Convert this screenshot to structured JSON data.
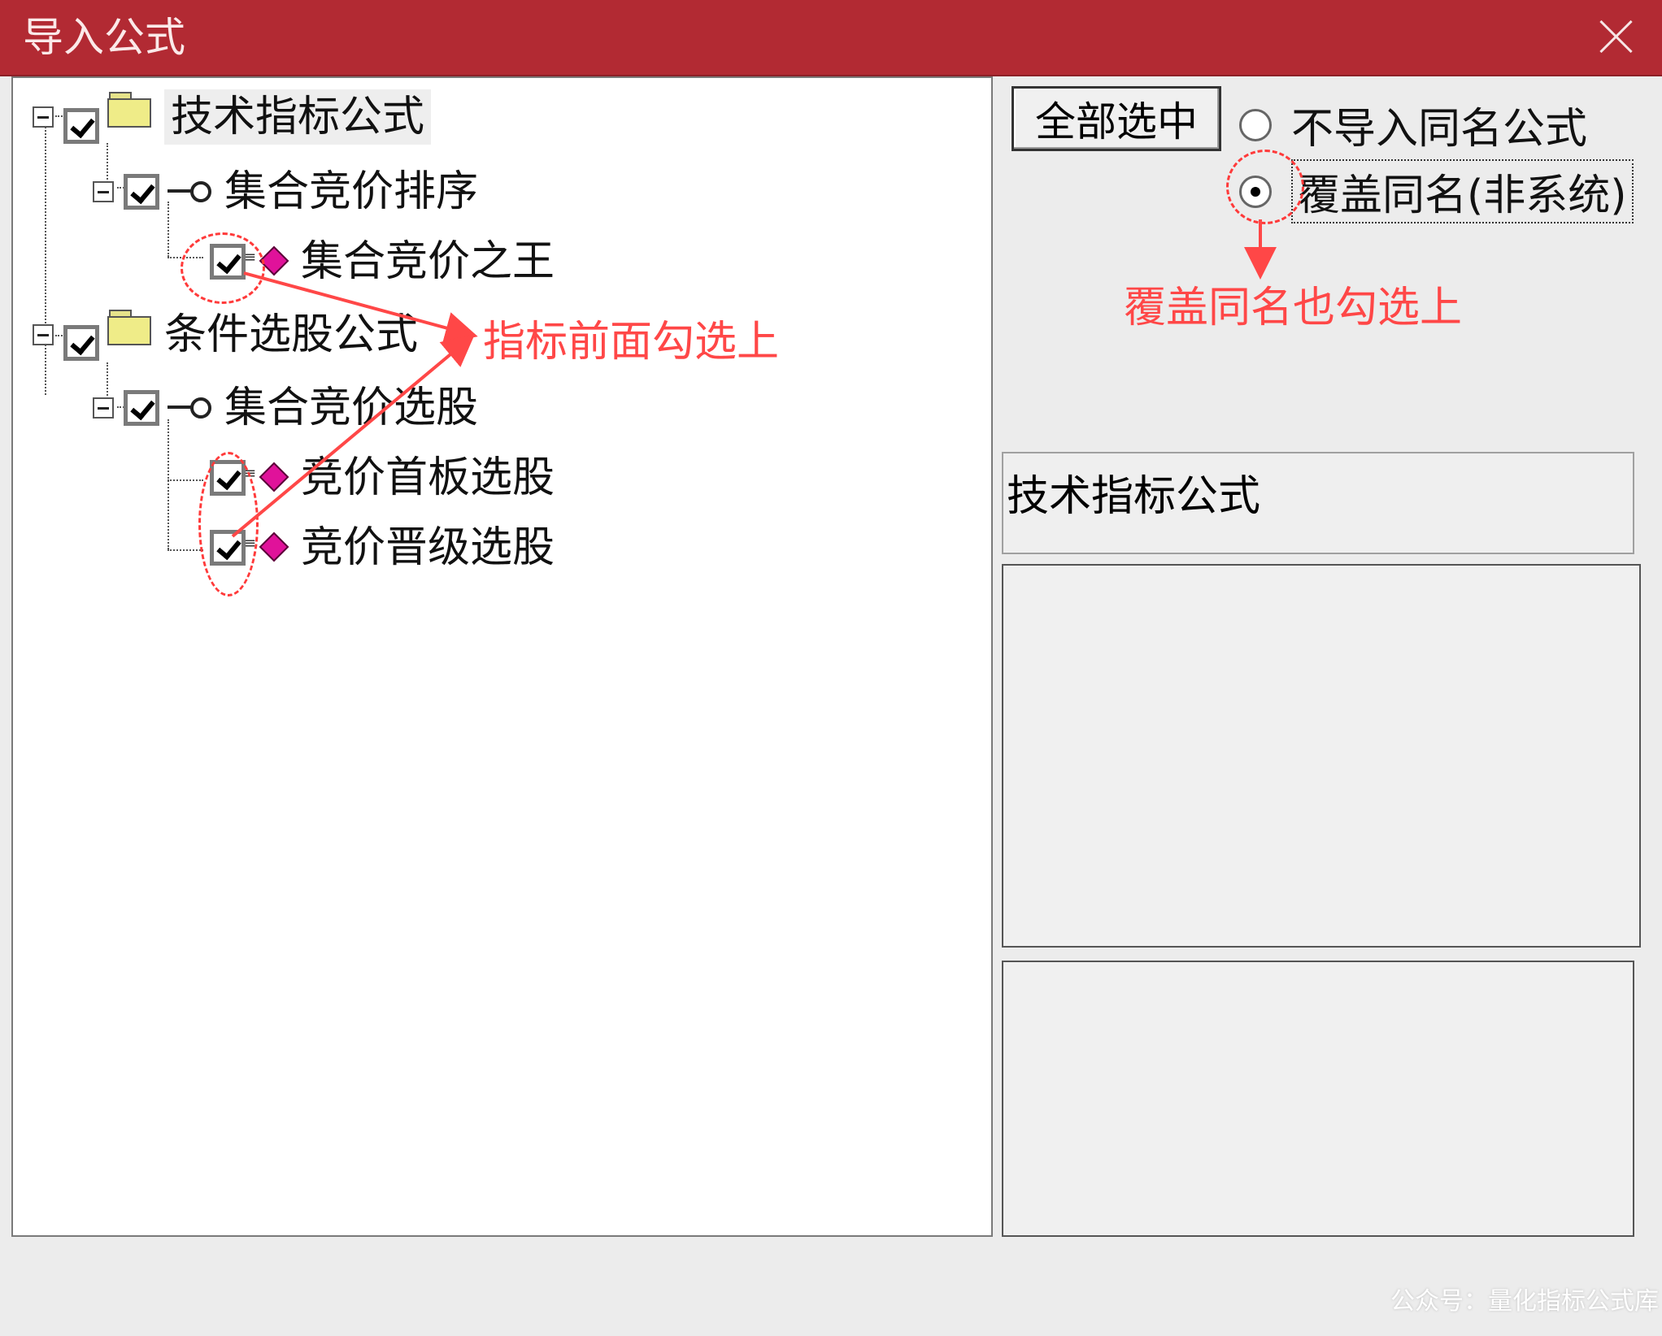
{
  "window": {
    "title": "导入公式"
  },
  "tree": {
    "items": [
      {
        "label": "技术指标公式"
      },
      {
        "label": "集合竞价排序"
      },
      {
        "label": "集合竞价之王"
      },
      {
        "label": "条件选股公式"
      },
      {
        "label": "集合竞价选股"
      },
      {
        "label": "竞价首板选股"
      },
      {
        "label": "竞价晋级选股"
      }
    ]
  },
  "options": {
    "select_all_label": "全部选中",
    "radio_no_import": "不导入同名公式",
    "radio_overwrite": "覆盖同名(非系统)",
    "selected_radio": "radio_overwrite"
  },
  "info": {
    "name_field": "技术指标公式"
  },
  "annotations": {
    "check_note": "指标前面勾选上",
    "overwrite_note": "覆盖同名也勾选上",
    "color": "#ff4747"
  },
  "watermark": "公众号：量化指标公式库",
  "colors": {
    "titlebar": "#b22a33",
    "gem": "#e0129a",
    "folder": "#efec88"
  }
}
